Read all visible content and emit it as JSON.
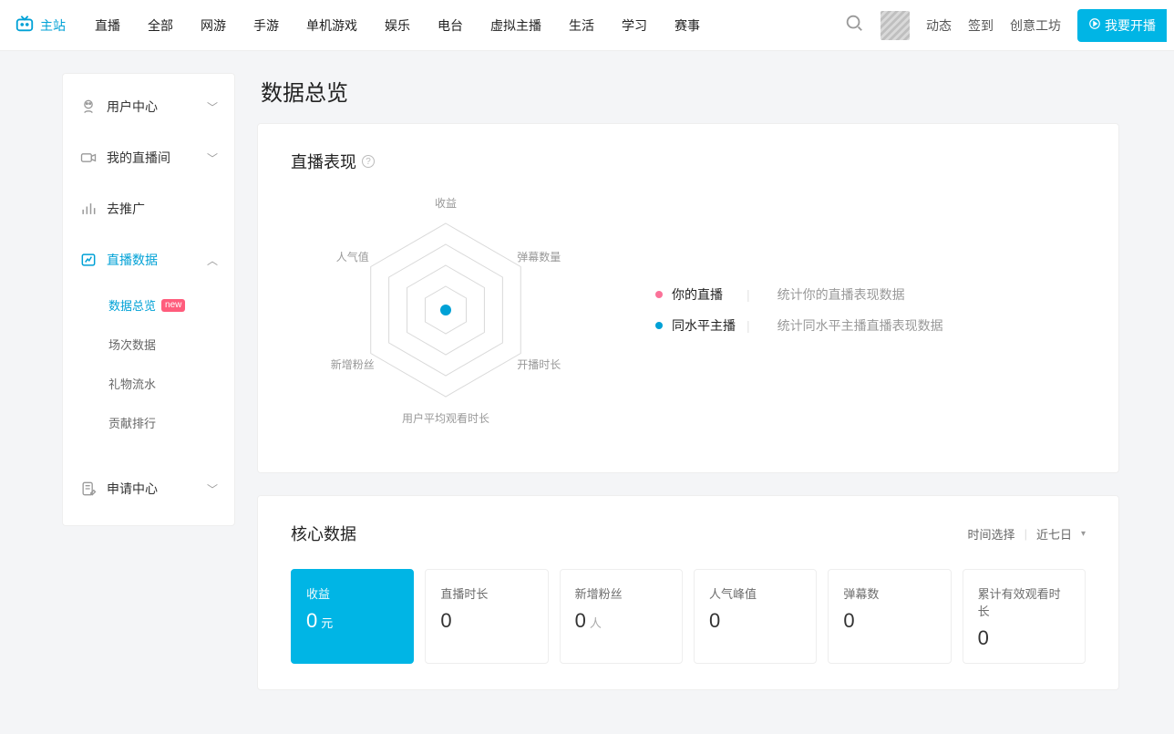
{
  "topnav": {
    "brand": "主站",
    "links": [
      "直播",
      "全部",
      "网游",
      "手游",
      "单机游戏",
      "娱乐",
      "电台",
      "虚拟主播",
      "生活",
      "学习",
      "赛事"
    ],
    "actions": [
      "动态",
      "签到",
      "创意工坊"
    ],
    "broadcast": "我要开播"
  },
  "sidebar": {
    "groups": [
      {
        "label": "用户中心",
        "icon": "user-center-icon",
        "open": false
      },
      {
        "label": "我的直播间",
        "icon": "camera-icon",
        "open": false
      },
      {
        "label": "去推广",
        "icon": "chart-icon",
        "leaf": true
      },
      {
        "label": "直播数据",
        "icon": "data-icon",
        "open": true,
        "active": true,
        "children": [
          {
            "label": "数据总览",
            "active": true,
            "badge": "new"
          },
          {
            "label": "场次数据"
          },
          {
            "label": "礼物流水"
          },
          {
            "label": "贡献排行"
          }
        ]
      },
      {
        "label": "申请中心",
        "icon": "apply-icon",
        "open": false
      }
    ]
  },
  "page_title": "数据总览",
  "radar": {
    "title": "直播表现",
    "axes": [
      "收益",
      "弹幕数量",
      "开播时长",
      "用户平均观看时长",
      "新增粉丝",
      "人气值"
    ],
    "legend": [
      {
        "color": "#fb7299",
        "name": "你的直播",
        "desc": "统计你的直播表现数据"
      },
      {
        "color": "#00a1d6",
        "name": "同水平主播",
        "desc": "统计同水平主播直播表现数据"
      }
    ]
  },
  "core": {
    "title": "核心数据",
    "time_label": "时间选择",
    "time_value": "近七日",
    "metrics": [
      {
        "label": "收益",
        "value": "0",
        "unit": "元",
        "active": true
      },
      {
        "label": "直播时长",
        "value": "0"
      },
      {
        "label": "新增粉丝",
        "value": "0",
        "unit": "人"
      },
      {
        "label": "人气峰值",
        "value": "0"
      },
      {
        "label": "弹幕数",
        "value": "0"
      },
      {
        "label": "累计有效观看时长",
        "value": "0"
      }
    ]
  },
  "chart_data": {
    "type": "radar",
    "axes": [
      "收益",
      "弹幕数量",
      "开播时长",
      "用户平均观看时长",
      "新增粉丝",
      "人气值"
    ],
    "series": [
      {
        "name": "你的直播",
        "values": [
          0,
          0,
          0,
          0,
          0,
          0
        ]
      },
      {
        "name": "同水平主播",
        "values": [
          0,
          0,
          0,
          0,
          0,
          0
        ]
      }
    ],
    "title": "直播表现",
    "range": [
      0,
      1
    ]
  }
}
